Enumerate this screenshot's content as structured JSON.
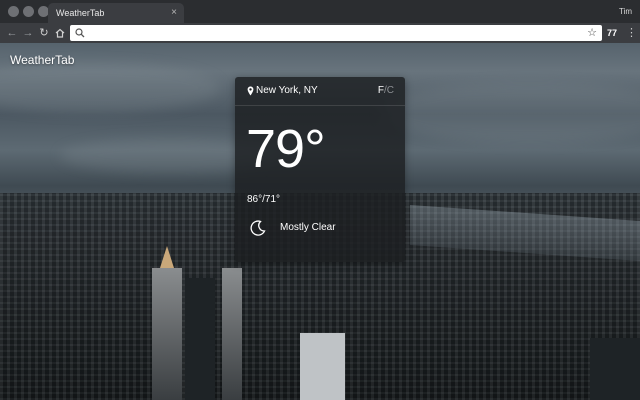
{
  "browser": {
    "tab_title": "WeatherTab",
    "tab_close": "×",
    "profile_name": "Tim",
    "address_value": "",
    "address_placeholder": "",
    "extension_badge": "77"
  },
  "page": {
    "brand": "WeatherTab"
  },
  "weather": {
    "location": "New York, NY",
    "unit_active": "F",
    "unit_separator": "/",
    "unit_inactive": "C",
    "temperature": "79°",
    "high_low": "86°/71°",
    "condition": "Mostly Clear",
    "condition_icon": "moon-icon"
  },
  "colors": {
    "chrome_dark": "#2b2d30",
    "toolbar": "#3b3d41",
    "card_bg": "#1c1e21",
    "text": "#ffffff"
  }
}
